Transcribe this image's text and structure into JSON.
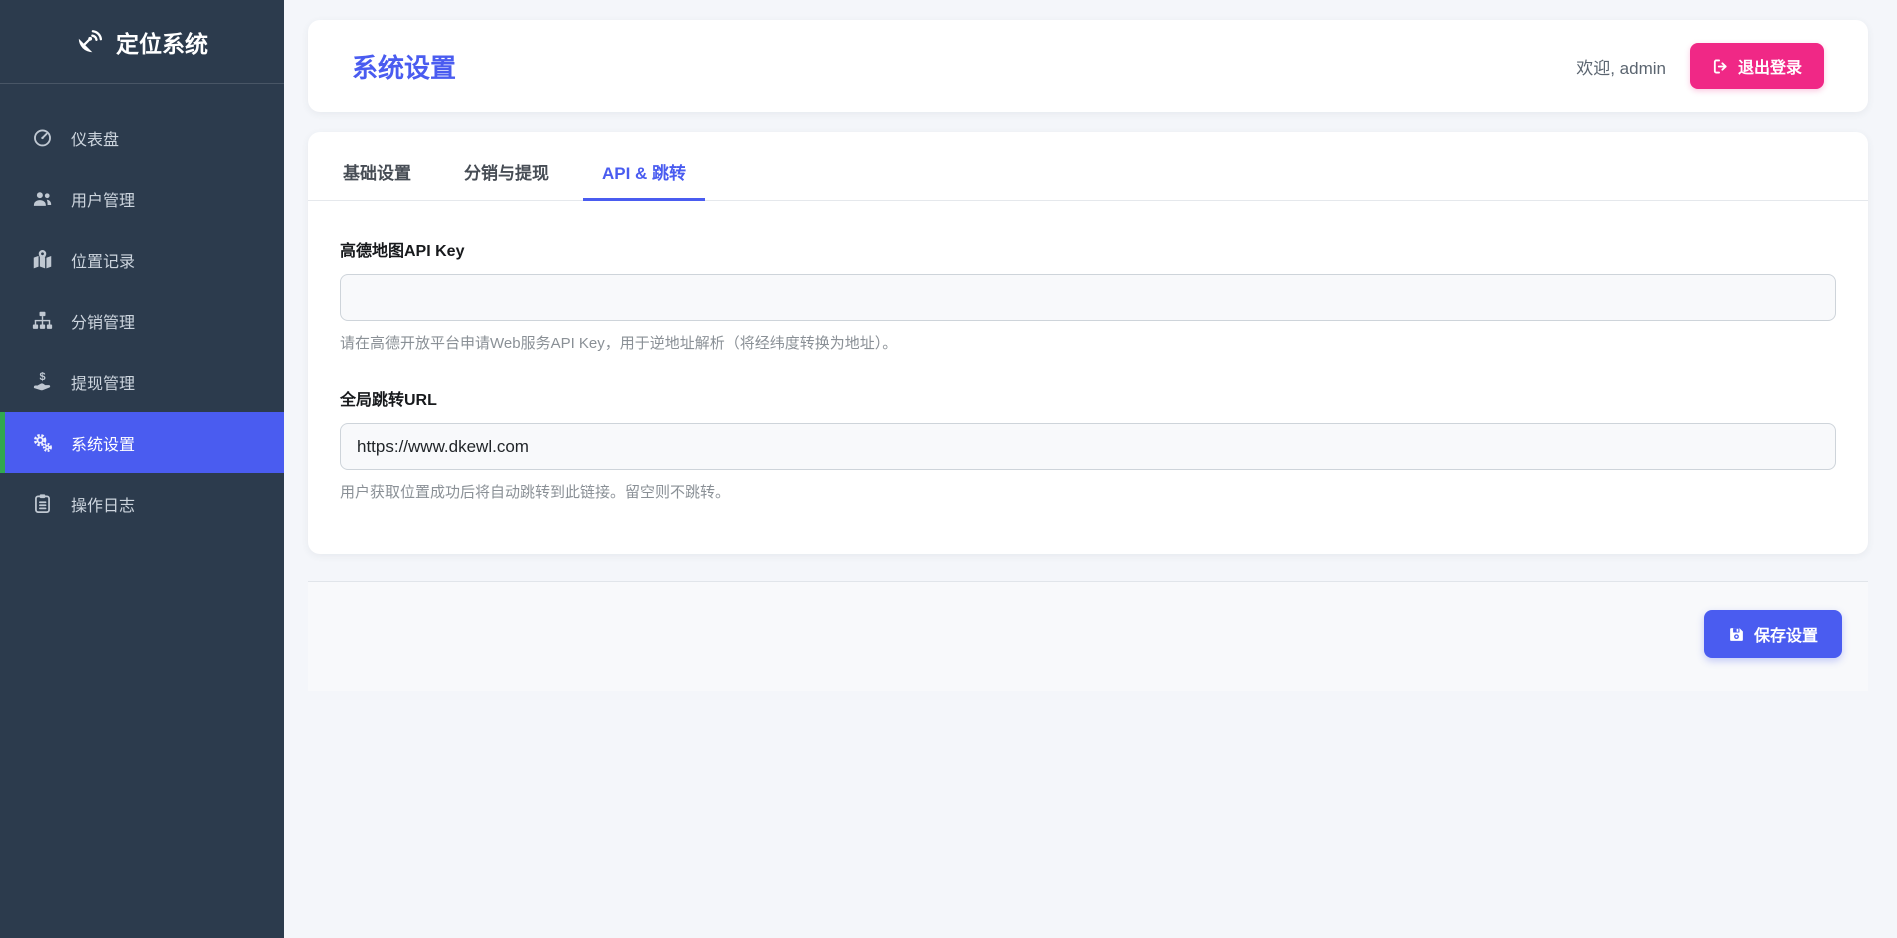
{
  "theme": {
    "accent": "#4a5cf0",
    "pink": "#f02886",
    "green": "#31a84f",
    "sidebar_bg": "#2c3b4d",
    "page_bg": "#f4f6fa"
  },
  "app": {
    "logo_text": "定位系统"
  },
  "sidebar": {
    "items": [
      {
        "label": "仪表盘",
        "icon": "gauge-icon",
        "active": false
      },
      {
        "label": "用户管理",
        "icon": "users-icon",
        "active": false
      },
      {
        "label": "位置记录",
        "icon": "map-marked-icon",
        "active": false
      },
      {
        "label": "分销管理",
        "icon": "sitemap-icon",
        "active": false
      },
      {
        "label": "提现管理",
        "icon": "hand-holding-dollar-icon",
        "active": false
      },
      {
        "label": "系统设置",
        "icon": "cogs-icon",
        "active": true
      },
      {
        "label": "操作日志",
        "icon": "clipboard-list-icon",
        "active": false
      }
    ]
  },
  "header": {
    "title": "系统设置",
    "welcome": "欢迎, admin",
    "logout_label": "退出登录"
  },
  "tabs": [
    {
      "label": "基础设置",
      "active": false
    },
    {
      "label": "分销与提现",
      "active": false
    },
    {
      "label": "API & 跳转",
      "active": true
    }
  ],
  "form": {
    "fields": [
      {
        "label": "高德地图API Key",
        "value": "",
        "placeholder": "",
        "help": "请在高德开放平台申请Web服务API Key，用于逆地址解析（将经纬度转换为地址）。"
      },
      {
        "label": "全局跳转URL",
        "value": "https://www.dkewl.com",
        "placeholder": "",
        "help": "用户获取位置成功后将自动跳转到此链接。留空则不跳转。"
      }
    ],
    "save_label": "保存设置"
  }
}
